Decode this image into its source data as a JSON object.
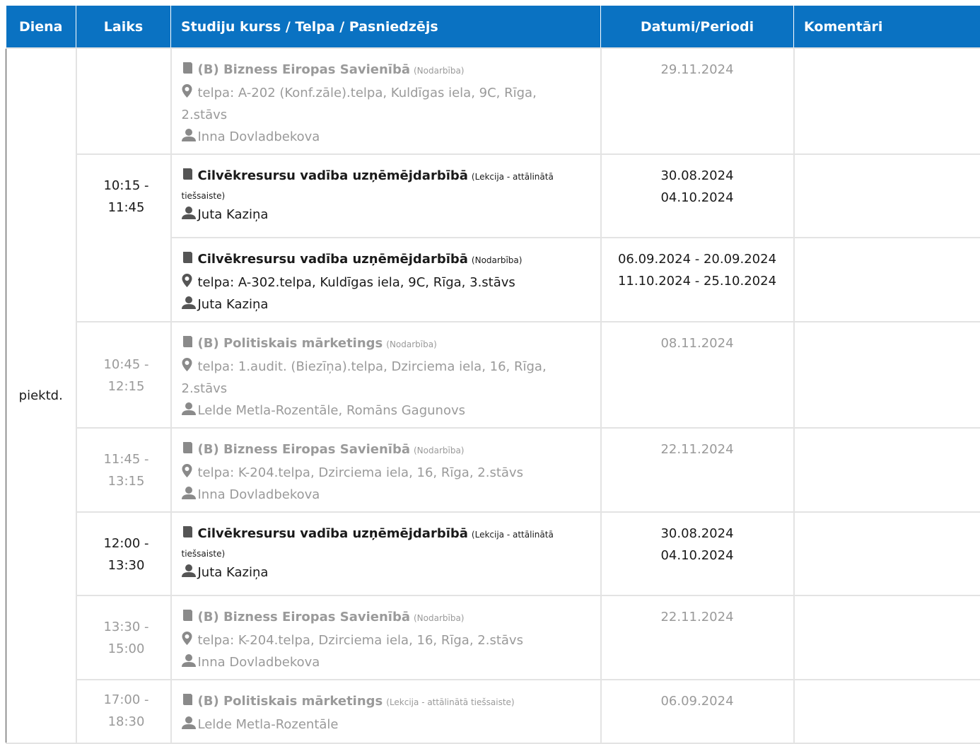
{
  "header": {
    "day": "Diena",
    "time": "Laiks",
    "course": "Studiju kurss / Telpa / Pasniedzējs",
    "dates": "Datumi/Periodi",
    "comments": "Komentāri"
  },
  "day_label": "piektd.",
  "rows": [
    {
      "time": "",
      "course": "(B) Bizness Eiropas Savienībā",
      "type": "(Nodarbība)",
      "room_line1": "telpa: A-202 (Konf.zāle).telpa, Kuldīgas iela, 9C, Rīga,",
      "room_line2": "2.stāvs",
      "teacher": "Inna Dovladbekova",
      "date1": "29.11.2024",
      "date2": "",
      "comment": ""
    },
    {
      "time1": "10:15 -",
      "time2": "11:45",
      "course": "Cilvēkresursu vadība uzņēmējdarbībā",
      "type1": "(Lekcija - attālinātā",
      "type2": "tiešsaiste)",
      "teacher": "Juta Kaziņa",
      "date1": "30.08.2024",
      "date2": "04.10.2024",
      "comment": ""
    },
    {
      "course": "Cilvēkresursu vadība uzņēmējdarbībā",
      "type": "(Nodarbība)",
      "room": "telpa: A-302.telpa, Kuldīgas iela, 9C, Rīga, 3.stāvs",
      "teacher": "Juta Kaziņa",
      "date1": "06.09.2024 - 20.09.2024",
      "date2": "11.10.2024 - 25.10.2024",
      "comment": ""
    },
    {
      "time1": "10:45 -",
      "time2": "12:15",
      "course": "(B) Politiskais mārketings",
      "type": "(Nodarbība)",
      "room_line1": "telpa: 1.audit. (Biezīņa).telpa, Dzirciema iela, 16, Rīga,",
      "room_line2": "2.stāvs",
      "teacher": "Lelde Metla-Rozentāle, Romāns Gagunovs",
      "date1": "08.11.2024",
      "comment": ""
    },
    {
      "time1": "11:45 -",
      "time2": "13:15",
      "course": "(B) Bizness Eiropas Savienībā",
      "type": "(Nodarbība)",
      "room": "telpa: K-204.telpa, Dzirciema iela, 16, Rīga, 2.stāvs",
      "teacher": "Inna Dovladbekova",
      "date1": "22.11.2024",
      "comment": ""
    },
    {
      "time1": "12:00 -",
      "time2": "13:30",
      "course": "Cilvēkresursu vadība uzņēmējdarbībā",
      "type1": "(Lekcija - attālinātā",
      "type2": "tiešsaiste)",
      "teacher": "Juta Kaziņa",
      "date1": "30.08.2024",
      "date2": "04.10.2024",
      "comment": ""
    },
    {
      "time1": "13:30 -",
      "time2": "15:00",
      "course": "(B) Bizness Eiropas Savienībā",
      "type": "(Nodarbība)",
      "room": "telpa: K-204.telpa, Dzirciema iela, 16, Rīga, 2.stāvs",
      "teacher": "Inna Dovladbekova",
      "date1": "22.11.2024",
      "comment": ""
    },
    {
      "time1": "17:00 -",
      "time2": "18:30",
      "course": "(B) Politiskais mārketings",
      "type": "(Lekcija - attālinātā tiešsaiste)",
      "teacher": "Lelde Metla-Rozentāle",
      "date1": "06.09.2024",
      "comment": ""
    }
  ],
  "colors": {
    "header_bg": "#0a72c2",
    "header_text": "#ffffff",
    "inactive_text": "#9a9a9a",
    "active_text": "#1a1a1a",
    "border": "#e3e3e3"
  },
  "icons": {
    "course": "book-icon",
    "room": "map-marker-icon",
    "teacher": "user-icon"
  }
}
